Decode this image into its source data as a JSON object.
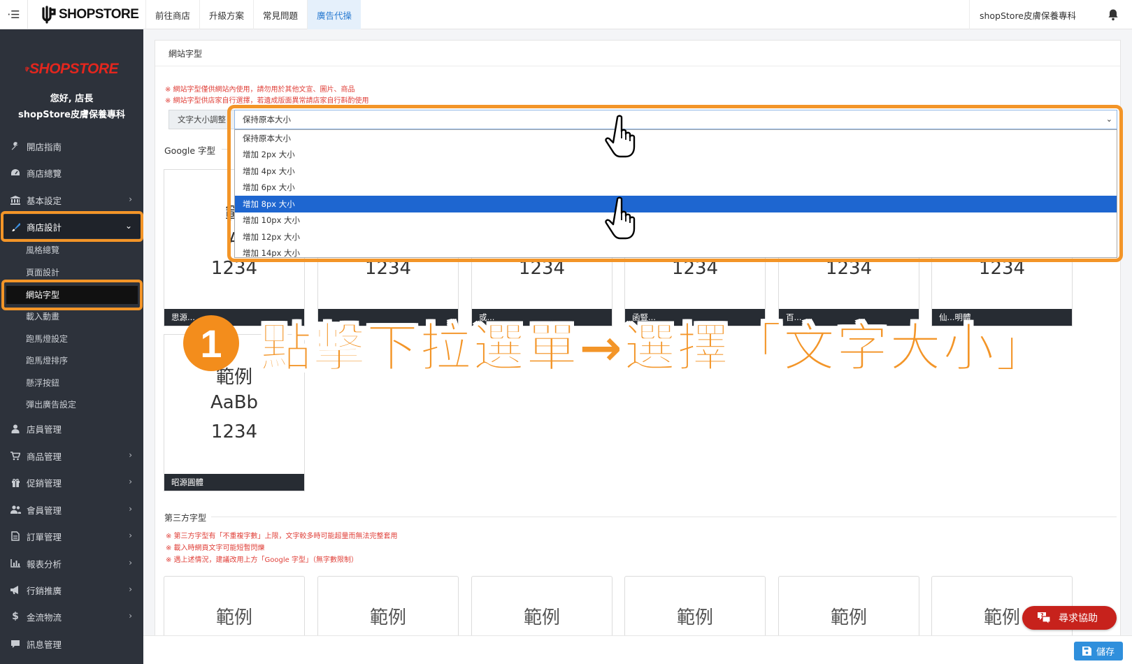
{
  "topbar": {
    "menu_icon": "hamburger-icon",
    "brand": "SHOPSTORE",
    "nav": [
      "前往商店",
      "升級方案",
      "常見問題",
      "廣告代操"
    ],
    "active_nav": "廣告代操",
    "store_name": "shopStore皮膚保養專科",
    "bell_icon": "bell-icon"
  },
  "sidebar": {
    "logo_text": "SHOPSTORE",
    "greeting": "您好, 店長",
    "store_name": "shopStore皮膚保養專科",
    "items": [
      {
        "label": "開店指南",
        "icon": "wrench-icon"
      },
      {
        "label": "商店總覽",
        "icon": "dashboard-icon"
      },
      {
        "label": "基本設定",
        "icon": "bank-icon"
      },
      {
        "label": "商店設計",
        "icon": "brush-icon"
      },
      {
        "label": "店員管理",
        "icon": "user-icon"
      },
      {
        "label": "商品管理",
        "icon": "cart-icon"
      },
      {
        "label": "促銷管理",
        "icon": "gift-icon"
      },
      {
        "label": "會員管理",
        "icon": "users-icon"
      },
      {
        "label": "訂單管理",
        "icon": "file-icon"
      },
      {
        "label": "報表分析",
        "icon": "chart-icon"
      },
      {
        "label": "行銷推廣",
        "icon": "megaphone-icon"
      },
      {
        "label": "金流物流",
        "icon": "dollar-icon"
      },
      {
        "label": "訊息管理",
        "icon": "message-icon"
      }
    ],
    "sub_items": [
      "風格總覽",
      "頁面設計",
      "網站字型",
      "載入動畫",
      "跑馬燈設定",
      "跑馬燈排序",
      "懸浮按鈕",
      "彈出廣告設定"
    ]
  },
  "panel": {
    "title": "網站字型",
    "notes": [
      "※ 網站字型僅供網站內使用，請勿用於其他文宣、圖片、商品",
      "※ 網站字型供店家自行選擇，若遺成版面異常請店家自行斟酌使用"
    ],
    "size_label": "文字大小調整",
    "size_selected": "保持原本大小",
    "size_options": [
      "保持原本大小",
      "增加 2px 大小",
      "增加 4px 大小",
      "增加 6px 大小",
      "增加 8px 大小",
      "增加 10px 大小",
      "增加 12px 大小",
      "增加 14px 大小"
    ],
    "highlighted_option": "增加 8px 大小",
    "google_title": "Google 字型",
    "font_cards": [
      {
        "lines": [
          "範",
          "A",
          "1234"
        ],
        "caption": "思源..."
      },
      {
        "lines": [
          "",
          "",
          "1234"
        ],
        "caption": ""
      },
      {
        "lines": [
          "",
          "",
          "1234"
        ],
        "caption": "或..."
      },
      {
        "lines": [
          "",
          "",
          "1234"
        ],
        "caption": "函豎..."
      },
      {
        "lines": [
          "",
          "",
          "1234"
        ],
        "caption": "百..."
      },
      {
        "lines": [
          "",
          "",
          "1234"
        ],
        "caption": "仙...明體"
      },
      {
        "lines": [
          "範例",
          "AaBb",
          "1234"
        ],
        "caption": "昭源圓體"
      }
    ],
    "third_title": "第三方字型",
    "third_notes": [
      "※ 第三方字型有「不重複字數」上限，文字較多時可能超量而無法完整套用",
      "※ 載入時網頁文字可能短暫閃爍",
      "※ 遇上述情況，建議改用上方「Google 字型」（無字數限制）"
    ],
    "third_sample": "範例"
  },
  "annotation": {
    "step": "1",
    "text": "點擊下拉選單→選擇「文字大小」"
  },
  "help_button": "尋求協助",
  "save_button": "儲存",
  "colors": {
    "highlight_orange": "#f39528",
    "sidebar_bg": "#2d323b",
    "select_blue": "#1e66d0",
    "help_red": "#c7221c",
    "save_blue": "#2f8fdc",
    "brand_red": "#e3261e"
  }
}
